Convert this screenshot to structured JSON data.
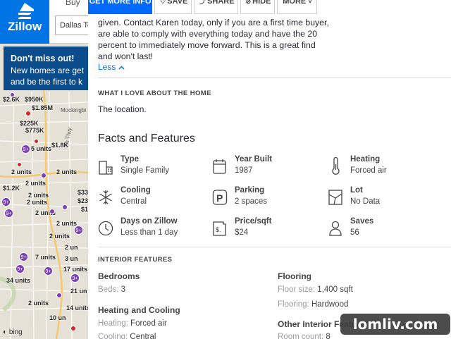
{
  "header": {
    "logo_text": "Zillow",
    "buy_tab": "Buy",
    "search_value": "Dallas Te"
  },
  "banner": {
    "title": "Don't miss out!",
    "line1": "New homes are get",
    "line2": "and be the first to k"
  },
  "map": {
    "street_labels": [
      "Mockingbi",
      "th Tlwy"
    ],
    "price_pins": [
      "$2.6K",
      "$950K",
      "$1.85M",
      "$225K",
      "$775K",
      "$1.8K",
      "$1.2K",
      "$33",
      "$23",
      "$1"
    ],
    "unit_pins": [
      "5 units",
      "2 units",
      "2 units",
      "2 units",
      "2 units",
      "2 units",
      "2 units",
      "2 units",
      "2 units",
      "7 units",
      "2 un",
      "3 un",
      "17 units",
      "21 un",
      "34 units",
      "14 units",
      "2 units",
      "10 un"
    ],
    "cluster_badges": [
      "9+",
      "9+",
      "9+",
      "9+",
      "9+",
      "9+",
      "9+",
      "9+"
    ],
    "attribution": "bing"
  },
  "actions": {
    "primary": "GET MORE INFO",
    "save": "SAVE",
    "share": "SHARE",
    "hide": "HIDE",
    "more": "MORE"
  },
  "description": {
    "text": "given. Contact Karen today, only if you are a first time buyer, are able to comply with everything today and have the 20 percent to immediately move forward. This is a great find and won't last!",
    "less_link": "Less"
  },
  "love": {
    "heading": "WHAT I LOVE ABOUT THE HOME",
    "text": "The location."
  },
  "facts": {
    "heading": "Facts and Features",
    "items": [
      {
        "label": "Type",
        "value": "Single Family",
        "icon": "house-icon"
      },
      {
        "label": "Year Built",
        "value": "1987",
        "icon": "calendar-icon"
      },
      {
        "label": "Heating",
        "value": "Forced air",
        "icon": "thermometer-icon"
      },
      {
        "label": "Cooling",
        "value": "Central",
        "icon": "snowflake-icon"
      },
      {
        "label": "Parking",
        "value": "2 spaces",
        "icon": "parking-icon"
      },
      {
        "label": "Lot",
        "value": "No Data",
        "icon": "lot-icon"
      },
      {
        "label": "Days on Zillow",
        "value": "Less than 1 day",
        "icon": "clock-icon"
      },
      {
        "label": "Price/sqft",
        "value": "$24",
        "icon": "price-tag-icon"
      },
      {
        "label": "Saves",
        "value": "56",
        "icon": "person-icon"
      }
    ]
  },
  "interior": {
    "heading": "INTERIOR FEATURES",
    "bedrooms": {
      "title": "Bedrooms",
      "key": "Beds:",
      "value": "3"
    },
    "flooring": {
      "title": "Flooring",
      "rows": [
        {
          "key": "Floor size:",
          "value": "1,400 sqft"
        },
        {
          "key": "Flooring:",
          "value": "Hardwood"
        }
      ]
    },
    "heating_cooling": {
      "title": "Heating and Cooling",
      "rows": [
        {
          "key": "Heating:",
          "value": "Forced air"
        },
        {
          "key": "Cooling:",
          "value": "Central"
        }
      ]
    },
    "other": {
      "title": "Other Interior Features",
      "rows": [
        {
          "key": "Room count:",
          "value": "8"
        }
      ]
    }
  },
  "watermark": "lomliv.com",
  "colors": {
    "brand_blue": "#0074e4",
    "action_blue": "#006aff",
    "banner_navy": "#0b4d8c",
    "pin_red": "#d4232c",
    "pin_purple": "#7b3fb8"
  }
}
